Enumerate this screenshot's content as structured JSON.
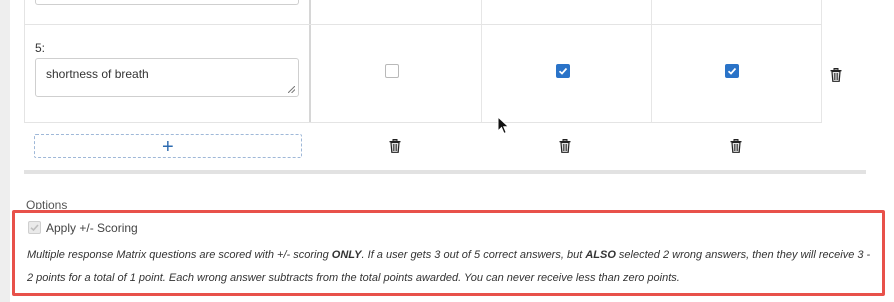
{
  "matrix": {
    "row": {
      "label": "5:",
      "answer_text": "shortness of breath",
      "checkboxes": [
        false,
        true,
        true
      ]
    },
    "add_row_symbol": "+",
    "icons": {
      "delete_row": "trash-icon",
      "delete_column": "trash-icon",
      "add_row": "plus-icon",
      "resize": "resize-handle-icon"
    }
  },
  "options": {
    "heading": "Options",
    "apply_scoring": {
      "label": "Apply +/- Scoring",
      "checked": true,
      "disabled": true
    },
    "note": {
      "p1": "Multiple response Matrix questions are scored with +/- scoring ",
      "b1": "ONLY",
      "p2": ". If a user gets 3 out of 5 correct answers, but ",
      "b2": "ALSO",
      "p3": " selected 2 wrong answers, then they will receive 3 - 2 points for a total of 1 point. Each wrong answer subtracts from the total points awarded. You can never receive less than zero points."
    }
  },
  "colors": {
    "highlight_border": "#e8514a",
    "checkbox_checked": "#2a73c8",
    "add_button_border": "#9fb8d8"
  }
}
